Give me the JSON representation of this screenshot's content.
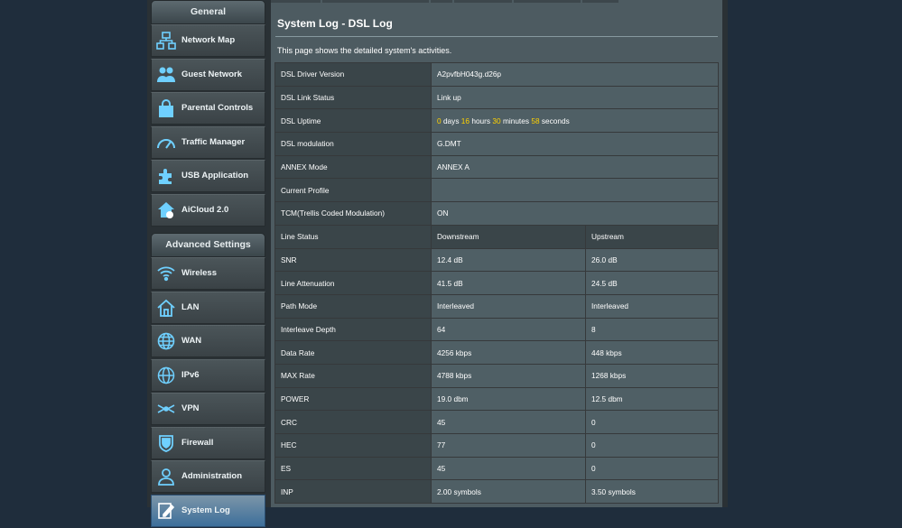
{
  "sidebar": {
    "general_title": "General",
    "general_items": [
      {
        "label": "Network Map",
        "icon": "network-map-icon"
      },
      {
        "label": "Guest Network",
        "icon": "guest-network-icon"
      },
      {
        "label": "Parental Controls",
        "icon": "parental-controls-icon"
      },
      {
        "label": "Traffic Manager",
        "icon": "traffic-manager-icon"
      },
      {
        "label": "USB Application",
        "icon": "usb-application-icon"
      },
      {
        "label": "AiCloud 2.0",
        "icon": "aicloud-icon"
      }
    ],
    "advanced_title": "Advanced Settings",
    "advanced_items": [
      {
        "label": "Wireless",
        "icon": "wireless-icon"
      },
      {
        "label": "LAN",
        "icon": "lan-icon"
      },
      {
        "label": "WAN",
        "icon": "wan-icon"
      },
      {
        "label": "IPv6",
        "icon": "ipv6-icon"
      },
      {
        "label": "VPN",
        "icon": "vpn-icon"
      },
      {
        "label": "Firewall",
        "icon": "firewall-icon"
      },
      {
        "label": "Administration",
        "icon": "administration-icon"
      },
      {
        "label": "System Log",
        "icon": "system-log-icon",
        "active": true
      }
    ]
  },
  "main": {
    "title": "System Log - DSL Log",
    "description": "This page shows the detailed system's activities.",
    "info": {
      "driver_label": "DSL Driver Version",
      "driver_value": "A2pvfbH043g.d26p",
      "link_label": "DSL Link Status",
      "link_value": "Link up",
      "uptime_label": "DSL Uptime",
      "uptime": {
        "days": "0",
        "days_unit": "days",
        "hours": "16",
        "hours_unit": "hours",
        "minutes": "30",
        "minutes_unit": "minutes",
        "seconds": "58",
        "seconds_unit": "seconds"
      },
      "modulation_label": "DSL modulation",
      "modulation_value": "G.DMT",
      "annex_label": "ANNEX Mode",
      "annex_value": "ANNEX A",
      "profile_label": "Current Profile",
      "profile_value": "",
      "tcm_label": "TCM(Trellis Coded Modulation)",
      "tcm_value": "ON"
    },
    "line_status": {
      "header": [
        "Line Status",
        "Downstream",
        "Upstream"
      ],
      "rows": [
        [
          "SNR",
          "12.4 dB",
          "26.0 dB"
        ],
        [
          "Line Attenuation",
          "41.5 dB",
          "24.5 dB"
        ],
        [
          "Path Mode",
          "Interleaved",
          "Interleaved"
        ],
        [
          "Interleave Depth",
          "64",
          "8"
        ],
        [
          "Data Rate",
          "4256 kbps",
          "448 kbps"
        ],
        [
          "MAX Rate",
          "4788 kbps",
          "1268 kbps"
        ],
        [
          "POWER",
          "19.0 dbm",
          "12.5 dbm"
        ],
        [
          "CRC",
          "45",
          "0"
        ],
        [
          "HEC",
          "77",
          "0"
        ],
        [
          "ES",
          "45",
          "0"
        ],
        [
          "INP",
          "2.00 symbols",
          "3.50 symbols"
        ]
      ]
    }
  },
  "colors": {
    "accent_value": "#ffd200",
    "active_item": "#3d6f9b"
  }
}
